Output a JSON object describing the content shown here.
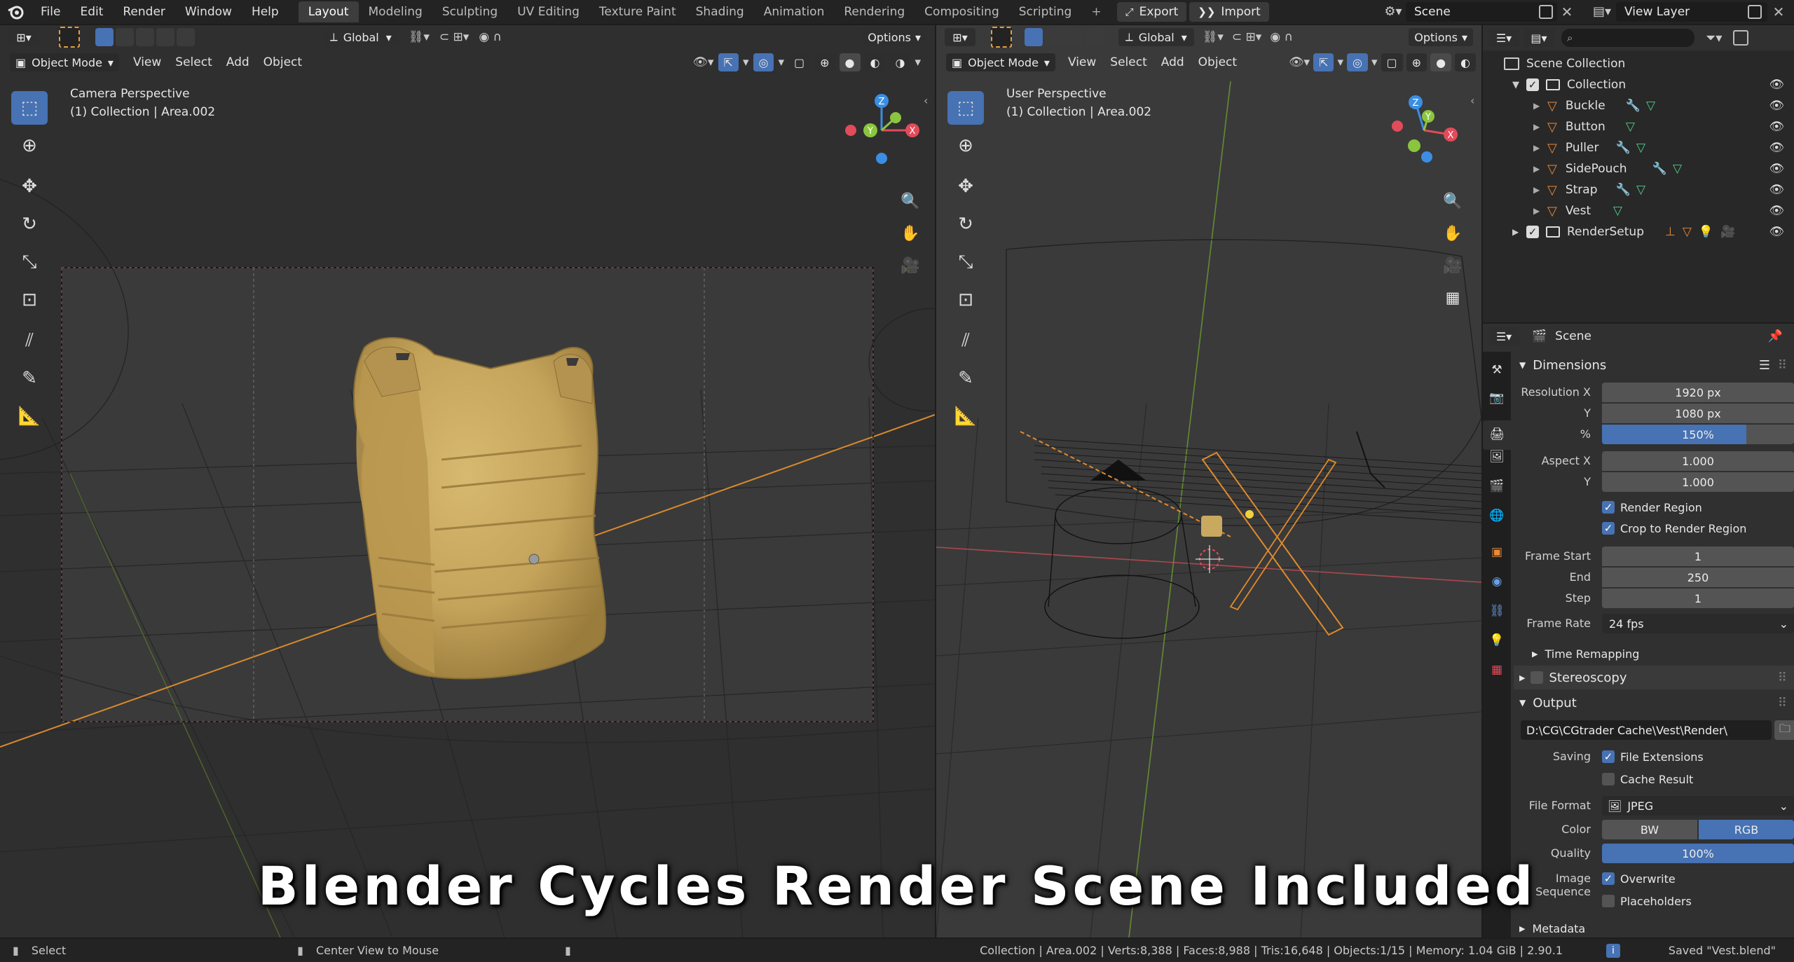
{
  "menu": {
    "items": [
      "File",
      "Edit",
      "Render",
      "Window",
      "Help"
    ],
    "workspaces": [
      "Layout",
      "Modeling",
      "Sculpting",
      "UV Editing",
      "Texture Paint",
      "Shading",
      "Animation",
      "Rendering",
      "Compositing",
      "Scripting"
    ],
    "add_tab": "+",
    "export_label": "Export",
    "import_label": "Import",
    "scene_name": "Scene",
    "view_layer": "View Layer"
  },
  "viewport_left": {
    "orientation": "Global",
    "options": "Options",
    "mode": "Object Mode",
    "menus": [
      "View",
      "Select",
      "Add",
      "Object"
    ],
    "title": "Camera Perspective",
    "subtitle": "(1) Collection | Area.002"
  },
  "viewport_right": {
    "orientation": "Global",
    "options": "Options",
    "mode": "Object Mode",
    "menus": [
      "View",
      "Select",
      "Add",
      "Object"
    ],
    "title": "User Perspective",
    "subtitle": "(1) Collection | Area.002"
  },
  "gizmo": {
    "x_color": "#e14b5a",
    "y_color": "#8bc53f",
    "z_color": "#3b8ee3"
  },
  "outliner": {
    "root": "Scene Collection",
    "collection": "Collection",
    "items": [
      "Buckle",
      "Button",
      "Puller",
      "SidePouch",
      "Strap",
      "Vest"
    ],
    "render_setup": "RenderSetup"
  },
  "properties": {
    "context": "Scene",
    "dimensions": {
      "title": "Dimensions",
      "resolution_x_label": "Resolution X",
      "resolution_x": "1920 px",
      "y_label": "Y",
      "resolution_y": "1080 px",
      "percent_label": "%",
      "percent": "150%",
      "percent_fill": 0.75,
      "aspect_x_label": "Aspect X",
      "aspect_x": "1.000",
      "aspect_y": "1.000",
      "render_region": "Render Region",
      "crop_region": "Crop to Render Region",
      "frame_start_label": "Frame Start",
      "frame_start": "1",
      "end_label": "End",
      "frame_end": "250",
      "step_label": "Step",
      "frame_step": "1",
      "frame_rate_label": "Frame Rate",
      "frame_rate": "24 fps",
      "time_remapping": "Time Remapping"
    },
    "stereoscopy": "Stereoscopy",
    "output": {
      "title": "Output",
      "path": "D:\\CG\\CGtrader Cache\\Vest\\Render\\",
      "saving_label": "Saving",
      "file_extensions": "File Extensions",
      "cache_result": "Cache Result",
      "file_format_label": "File Format",
      "file_format": "JPEG",
      "color_label": "Color",
      "color_bw": "BW",
      "color_rgb": "RGB",
      "quality_label": "Quality",
      "quality": "100%",
      "image_sequence_label": "Image Sequence",
      "overwrite": "Overwrite",
      "placeholders": "Placeholders"
    },
    "metadata": "Metadata"
  },
  "status": {
    "select": "Select",
    "center_view": "Center View to Mouse",
    "stats": "Collection | Area.002 | Verts:8,388 | Faces:8,988 | Tris:16,648 | Objects:1/15 | Memory: 1.04 GiB | 2.90.1",
    "saved": "Saved \"Vest.blend\""
  },
  "caption": "Blender Cycles Render Scene Included",
  "colors": {
    "accent": "#4772b3",
    "vest": "#c9a860",
    "camera_line": "#e08a2c"
  }
}
